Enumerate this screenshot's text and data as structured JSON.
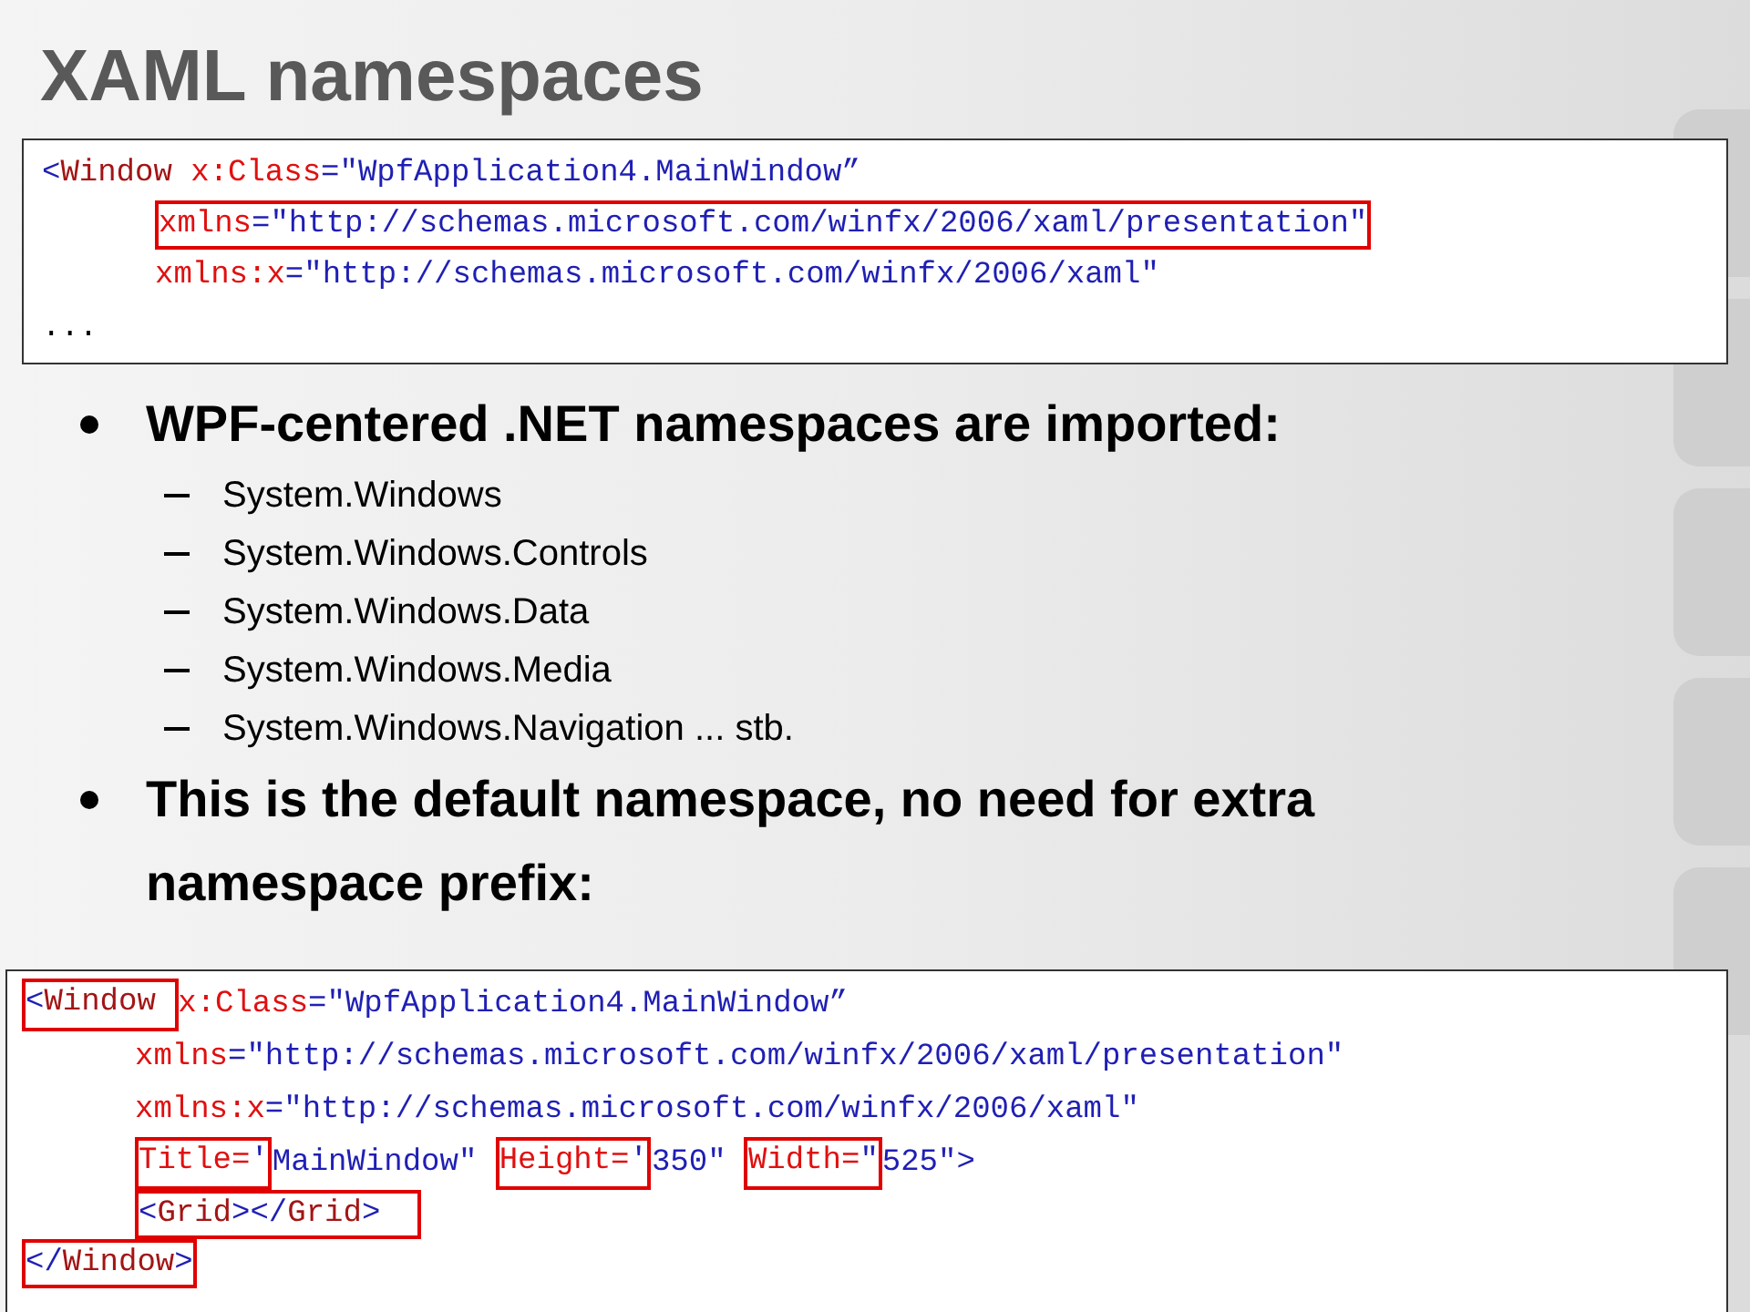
{
  "title": "XAML namespaces",
  "code_top": [
    {
      "tokens": [
        {
          "kind": "punct",
          "text": "<",
          "boxed": false
        },
        {
          "kind": "tag",
          "text": "Window ",
          "boxed": false
        },
        {
          "kind": "attr",
          "text": "x:Class",
          "boxed": false
        },
        {
          "kind": "punct",
          "text": "=",
          "boxed": false
        },
        {
          "kind": "value",
          "text": "\"WpfApplication4.MainWindow”",
          "boxed": false
        }
      ],
      "children": [
        {
          "tokens": [
            {
              "kind": "attr",
              "text": "xmlns",
              "boxed": true
            },
            {
              "kind": "punct",
              "text": "=",
              "boxed": true
            },
            {
              "kind": "value",
              "text": "\"http://schemas.microsoft.com/winfx/2006/xaml/presentation\"",
              "boxed": true
            }
          ]
        },
        {
          "tokens": [
            {
              "kind": "attr",
              "text": "xmlns:x",
              "boxed": false
            },
            {
              "kind": "punct",
              "text": "=",
              "boxed": false
            },
            {
              "kind": "value",
              "text": "\"http://schemas.microsoft.com/winfx/2006/xaml\"",
              "boxed": false
            }
          ]
        }
      ]
    },
    {
      "tokens": [
        {
          "kind": "plain",
          "text": "...",
          "boxed": false
        }
      ]
    }
  ],
  "bullets": [
    {
      "text": "WPF-centered .NET namespaces are imported:",
      "children": [
        {
          "text": "System.Windows"
        },
        {
          "text": "System.Windows.Controls"
        },
        {
          "text": "System.Windows.Data"
        },
        {
          "text": "System.Windows.Media"
        },
        {
          "text": "System.Windows.Navigation ... stb."
        }
      ]
    },
    {
      "text": "This is the default namespace, no need for extra namespace prefix:"
    }
  ],
  "code_bottom": [
    {
      "tokens": [
        {
          "kind": "punct",
          "text": "<",
          "boxed": true
        },
        {
          "kind": "tag",
          "text": "Window ",
          "boxed": true
        },
        {
          "kind": "attr",
          "text": "x:Class",
          "boxed": false
        },
        {
          "kind": "punct",
          "text": "=",
          "boxed": false
        },
        {
          "kind": "value",
          "text": "\"WpfApplication4.MainWindow”",
          "boxed": false
        }
      ],
      "children": [
        {
          "tokens": [
            {
              "kind": "attr",
              "text": "xmlns",
              "boxed": false
            },
            {
              "kind": "punct",
              "text": "=",
              "boxed": false
            },
            {
              "kind": "value",
              "text": "\"http://schemas.microsoft.com/winfx/2006/xaml/presentation\"",
              "boxed": false
            }
          ]
        },
        {
          "tokens": [
            {
              "kind": "attr",
              "text": "xmlns:x",
              "boxed": false
            },
            {
              "kind": "punct",
              "text": "=",
              "boxed": false
            },
            {
              "kind": "value",
              "text": "\"http://schemas.microsoft.com/winfx/2006/xaml\"",
              "boxed": false
            }
          ]
        },
        {
          "tokens": [
            {
              "kind": "attr",
              "text": "Title=",
              "boxed": true
            },
            {
              "kind": "value",
              "text": "'",
              "boxed": true
            },
            {
              "kind": "value",
              "text": "MainWindow\" ",
              "boxed": false
            },
            {
              "kind": "attr",
              "text": "Height=",
              "boxed": true
            },
            {
              "kind": "value",
              "text": "'",
              "boxed": true
            },
            {
              "kind": "value",
              "text": "350\" ",
              "boxed": false
            },
            {
              "kind": "attr",
              "text": "Width=",
              "boxed": true
            },
            {
              "kind": "value",
              "text": "\"",
              "boxed": true
            },
            {
              "kind": "value",
              "text": "525\">",
              "boxed": false
            }
          ]
        },
        {
          "tokens": [
            {
              "kind": "punct",
              "text": "<",
              "boxed": true
            },
            {
              "kind": "tag",
              "text": "Grid",
              "boxed": true
            },
            {
              "kind": "punct",
              "text": "></",
              "boxed": true
            },
            {
              "kind": "tag",
              "text": "Grid",
              "boxed": true
            },
            {
              "kind": "punct",
              "text": ">  ",
              "boxed": true
            }
          ]
        }
      ]
    },
    {
      "tokens": [
        {
          "kind": "punct",
          "text": "</",
          "boxed": true
        },
        {
          "kind": "tag",
          "text": "Window",
          "boxed": true
        },
        {
          "kind": "punct",
          "text": ">",
          "boxed": true
        }
      ]
    }
  ]
}
